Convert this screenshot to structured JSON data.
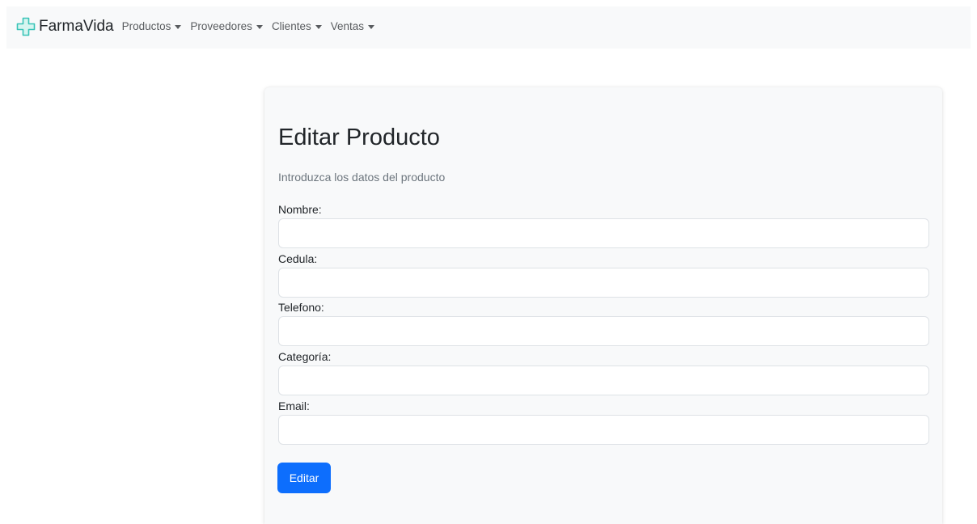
{
  "navbar": {
    "brand": "FarmaVida",
    "brand_icon": "medical-cross-icon",
    "accent_color": "#3ac4b8",
    "items": [
      {
        "label": "Productos"
      },
      {
        "label": "Proveedores"
      },
      {
        "label": "Clientes"
      },
      {
        "label": "Ventas"
      }
    ]
  },
  "form": {
    "title": "Editar Producto",
    "subtitle": "Introduzca los datos del producto",
    "fields": [
      {
        "label": "Nombre:",
        "value": ""
      },
      {
        "label": "Cedula:",
        "value": ""
      },
      {
        "label": "Telefono:",
        "value": ""
      },
      {
        "label": "Categoría:",
        "value": ""
      },
      {
        "label": "Email:",
        "value": ""
      }
    ],
    "submit_label": "Editar",
    "submit_color": "#0d6efd"
  }
}
